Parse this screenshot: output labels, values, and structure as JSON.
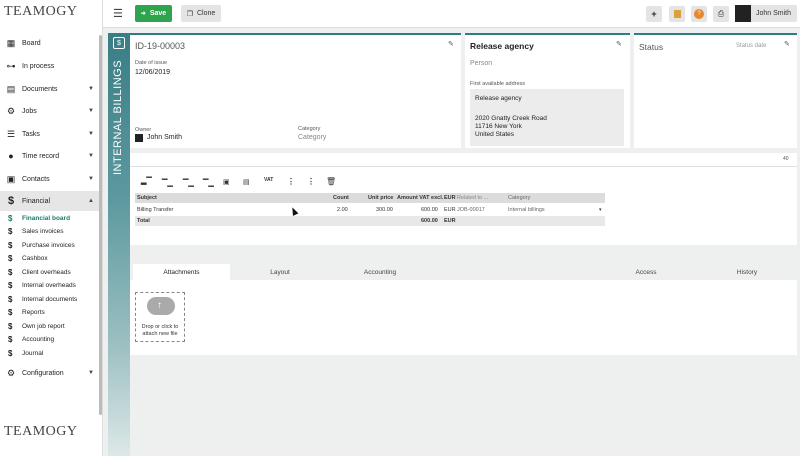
{
  "brand": {
    "logo": "TEAMOGY"
  },
  "sidebar": {
    "items": [
      {
        "label": "Board",
        "icon": "grid-icon"
      },
      {
        "label": "In process",
        "icon": "hierarchy-icon"
      },
      {
        "label": "Documents",
        "icon": "document-icon"
      },
      {
        "label": "Jobs",
        "icon": "gears-icon"
      },
      {
        "label": "Tasks",
        "icon": "tasks-icon"
      },
      {
        "label": "Time record",
        "icon": "clock-icon"
      },
      {
        "label": "Contacts",
        "icon": "contacts-icon"
      },
      {
        "label": "Financial",
        "icon": "dollar-icon"
      }
    ],
    "financial_sub": [
      "Financial board",
      "Sales invoices",
      "Purchase invoices",
      "Cashbox",
      "Client overheads",
      "Internal overheads",
      "Internal documents",
      "Reports",
      "Own job report",
      "Accounting",
      "Journal"
    ],
    "configuration": "Configuration"
  },
  "toolbar": {
    "save_label": "Save",
    "clone_label": "Clone",
    "user_name": "John Smith"
  },
  "doc": {
    "vertical_title": "INTERNAL BILLINGS",
    "id": "ID-19-00003",
    "date_label": "Date of issue",
    "date_value": "12/06/2019",
    "owner_label": "Owner",
    "owner_value": "John Smith",
    "category_label": "Category",
    "category_placeholder": "Category"
  },
  "agency": {
    "title": "Release agency",
    "person_placeholder": "Person",
    "address_label": "First available address",
    "address_name": "Release agency",
    "address_street": "2020 Gnatty Creek Road",
    "address_city": "11716 New York",
    "address_country": "United States"
  },
  "status": {
    "title": "Status",
    "date_placeholder": "Status date"
  },
  "table": {
    "count_indicator": "40",
    "headers": [
      "Subject",
      "Count",
      "Unit price",
      "Amount VAT excl.",
      "EUR",
      "Related to ...",
      "Category"
    ],
    "row": {
      "subject": "Billing Transfer",
      "count": "2.00",
      "unit_price": "300.00",
      "amount": "600.00",
      "currency": "EUR",
      "related": "JOB-00017",
      "category": "Internal billings"
    },
    "total": {
      "label": "Total",
      "amount": "600.00",
      "currency": "EUR"
    }
  },
  "tabs": [
    "Attachments",
    "Layout",
    "Accounting",
    "Access",
    "History"
  ],
  "upload": {
    "line1": "Drop or click to",
    "line2": "attach new file"
  },
  "colors": {
    "accent": "#2e7d85",
    "save": "#2fa44f",
    "active_nav": "#1a7a6e"
  }
}
